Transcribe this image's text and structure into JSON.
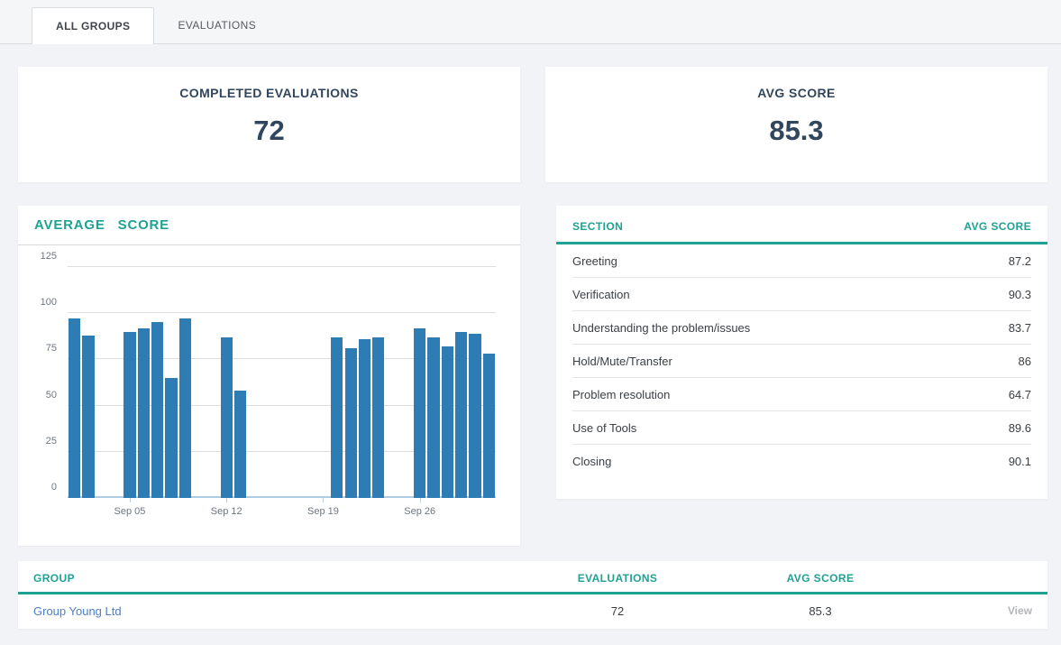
{
  "tabs": [
    {
      "label": "ALL GROUPS",
      "active": true
    },
    {
      "label": "EVALUATIONS",
      "active": false
    }
  ],
  "stats": [
    {
      "title": "COMPLETED EVALUATIONS",
      "value": "72"
    },
    {
      "title": "AVG SCORE",
      "value": "85.3"
    }
  ],
  "chart_data": {
    "type": "bar",
    "title": "AVERAGE SCORE",
    "bar_color": "#2d7cb4",
    "ylim": [
      0,
      125
    ],
    "yticks": [
      0,
      25,
      50,
      75,
      100,
      125
    ],
    "days_total": 31,
    "xticks": [
      {
        "label": "Sep 05",
        "day_index": 4
      },
      {
        "label": "Sep 12",
        "day_index": 11
      },
      {
        "label": "Sep 19",
        "day_index": 18
      },
      {
        "label": "Sep 26",
        "day_index": 25
      }
    ],
    "bars": [
      {
        "date": "Sep 01",
        "day_index": 0,
        "value": 97
      },
      {
        "date": "Sep 02",
        "day_index": 1,
        "value": 88
      },
      {
        "date": "Sep 05",
        "day_index": 4,
        "value": 90
      },
      {
        "date": "Sep 06",
        "day_index": 5,
        "value": 92
      },
      {
        "date": "Sep 07",
        "day_index": 6,
        "value": 95
      },
      {
        "date": "Sep 08",
        "day_index": 7,
        "value": 65
      },
      {
        "date": "Sep 09",
        "day_index": 8,
        "value": 97
      },
      {
        "date": "Sep 12",
        "day_index": 11,
        "value": 87
      },
      {
        "date": "Sep 13",
        "day_index": 12,
        "value": 58
      },
      {
        "date": "Sep 20",
        "day_index": 19,
        "value": 87
      },
      {
        "date": "Sep 21",
        "day_index": 20,
        "value": 81
      },
      {
        "date": "Sep 22",
        "day_index": 21,
        "value": 86
      },
      {
        "date": "Sep 23",
        "day_index": 22,
        "value": 87
      },
      {
        "date": "Sep 26",
        "day_index": 25,
        "value": 92
      },
      {
        "date": "Sep 27",
        "day_index": 26,
        "value": 87
      },
      {
        "date": "Sep 28",
        "day_index": 27,
        "value": 82
      },
      {
        "date": "Sep 29",
        "day_index": 28,
        "value": 90
      },
      {
        "date": "Sep 30",
        "day_index": 29,
        "value": 89
      },
      {
        "date": "Oct 01",
        "day_index": 30,
        "value": 78
      }
    ]
  },
  "section_table": {
    "header_section": "SECTION",
    "header_score": "AVG SCORE",
    "rows": [
      {
        "section": "Greeting",
        "avg_score": "87.2"
      },
      {
        "section": "Verification",
        "avg_score": "90.3"
      },
      {
        "section": "Understanding the problem/issues",
        "avg_score": "83.7"
      },
      {
        "section": "Hold/Mute/Transfer",
        "avg_score": "86"
      },
      {
        "section": "Problem resolution",
        "avg_score": "64.7"
      },
      {
        "section": "Use of Tools",
        "avg_score": "89.6"
      },
      {
        "section": "Closing",
        "avg_score": "90.1"
      }
    ]
  },
  "group_table": {
    "header_group": "GROUP",
    "header_evaluations": "EVALUATIONS",
    "header_score": "AVG SCORE",
    "rows": [
      {
        "group": "Group Young Ltd",
        "evaluations": "72",
        "avg_score": "85.3",
        "action": "View"
      }
    ]
  },
  "colors": {
    "accent_teal": "#1fa293",
    "bar_blue": "#2d7cb4",
    "stat_navy": "#31465c",
    "link_blue": "#4c7fc8"
  }
}
